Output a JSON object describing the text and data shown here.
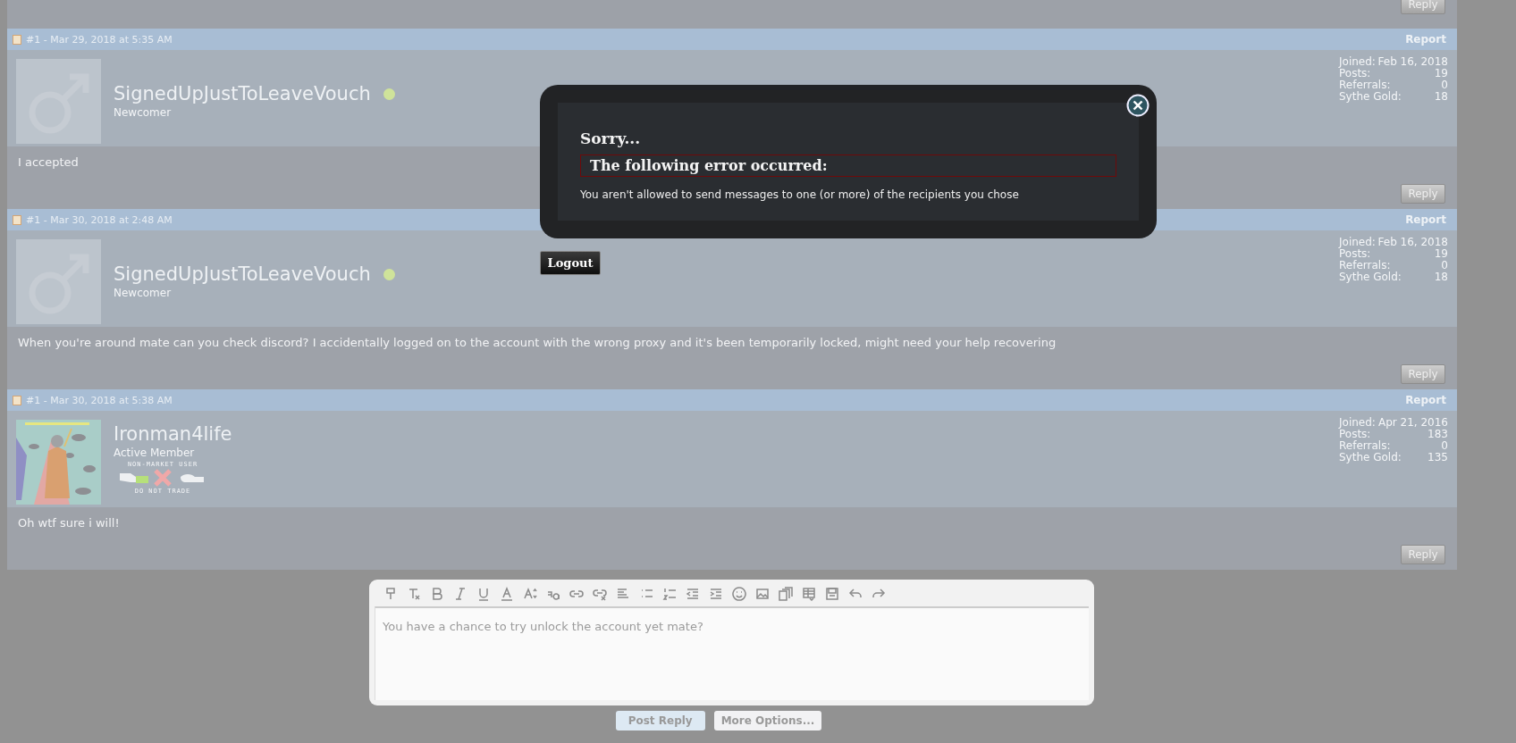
{
  "top_post": {
    "reply_button": "Reply"
  },
  "posts": [
    {
      "header": "#1 - Mar 29, 2018 at 5:35 AM",
      "report": "Report",
      "username": "SignedUpJustToLeaveVouch",
      "online": true,
      "rank": "Newcomer",
      "avatar": {
        "kind": "default"
      },
      "stats": [
        {
          "label": "Joined:",
          "value": "Feb 16, 2018"
        },
        {
          "label": "Posts:",
          "value": "19"
        },
        {
          "label": "Referrals:",
          "value": "0"
        },
        {
          "label": "Sythe Gold:",
          "value": "18"
        }
      ],
      "message": "I accepted",
      "reply_button": "Reply"
    },
    {
      "header": "#1 - Mar 30, 2018 at 2:48 AM",
      "report": "Report",
      "username": "SignedUpJustToLeaveVouch",
      "online": true,
      "rank": "Newcomer",
      "avatar": {
        "kind": "default"
      },
      "stats": [
        {
          "label": "Joined:",
          "value": "Feb 16, 2018"
        },
        {
          "label": "Posts:",
          "value": "19"
        },
        {
          "label": "Referrals:",
          "value": "0"
        },
        {
          "label": "Sythe Gold:",
          "value": "18"
        }
      ],
      "message": "When you're around mate can you check discord? I accidentally logged on to the account with the wrong proxy and it's been temporarily locked, might need your help recovering",
      "reply_button": "Reply"
    },
    {
      "header": "#1 - Mar 30, 2018 at 5:38 AM",
      "report": "Report",
      "username": "Ironman4life",
      "online": false,
      "rank": "Active Member",
      "badge": {
        "top": "NON-MARKET USER",
        "bottom": "DO NOT TRADE"
      },
      "stats": [
        {
          "label": "Joined:",
          "value": "Apr 21, 2016"
        },
        {
          "label": "Posts:",
          "value": "183"
        },
        {
          "label": "Referrals:",
          "value": "0"
        },
        {
          "label": "Sythe Gold:",
          "value": "135"
        }
      ],
      "message": "Oh wtf sure i will!",
      "reply_button": "Reply"
    }
  ],
  "editor": {
    "value": "You have a chance to try unlock the account yet mate?"
  },
  "buttons": [
    {
      "label": "Post Reply",
      "kind": "primary"
    },
    {
      "label": "More Options...",
      "kind": "secondary"
    }
  ],
  "dialog": {
    "title": "Sorry...",
    "error_heading": "The following error occurred:",
    "message": "You aren't allowed to send messages to one (or more) of the recipients you chose"
  },
  "logout_button": "Logout"
}
